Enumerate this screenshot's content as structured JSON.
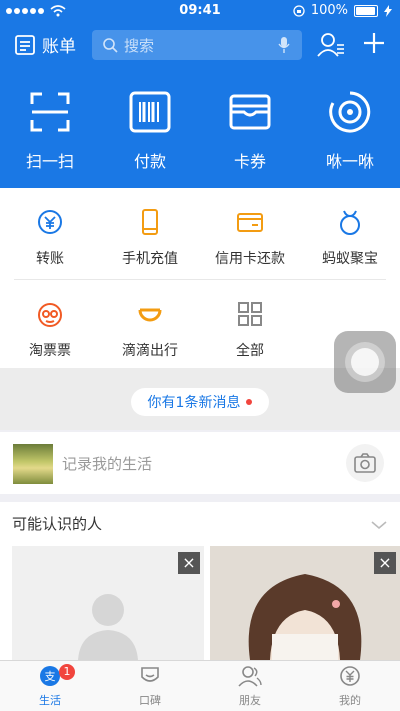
{
  "status": {
    "time": "09:41",
    "battery": "100%"
  },
  "nav": {
    "bill_label": "账单",
    "search_placeholder": "搜索"
  },
  "quick_actions": [
    {
      "label": "扫一扫",
      "icon": "scan-icon"
    },
    {
      "label": "付款",
      "icon": "barcode-icon"
    },
    {
      "label": "卡券",
      "icon": "card-wallet-icon"
    },
    {
      "label": "咻一咻",
      "icon": "xiu-ripple-icon"
    }
  ],
  "services": [
    {
      "label": "转账",
      "icon": "transfer-icon",
      "color": "#1a78e5"
    },
    {
      "label": "手机充值",
      "icon": "phone-recharge-icon",
      "color": "#f39c12"
    },
    {
      "label": "信用卡还款",
      "icon": "credit-card-icon",
      "color": "#f39c12"
    },
    {
      "label": "蚂蚁聚宝",
      "icon": "ant-fortune-icon",
      "color": "#1a78e5"
    },
    {
      "label": "淘票票",
      "icon": "taopiaopiao-icon",
      "color": "#f15a24"
    },
    {
      "label": "滴滴出行",
      "icon": "didi-icon",
      "color": "#f39c12"
    },
    {
      "label": "全部",
      "icon": "grid-all-icon",
      "color": "#888888"
    }
  ],
  "message": {
    "text": "你有1条新消息"
  },
  "record": {
    "text": "记录我的生活"
  },
  "people": {
    "title": "可能认识的人"
  },
  "tabs": [
    {
      "label": "生活",
      "icon": "life-icon",
      "badge": "1"
    },
    {
      "label": "口碑",
      "icon": "koubei-icon"
    },
    {
      "label": "朋友",
      "icon": "friends-icon"
    },
    {
      "label": "我的",
      "icon": "my-wallet-icon"
    }
  ],
  "colors": {
    "brand": "#1a78e5",
    "badge": "#f1453d",
    "accent_orange": "#f39c12"
  }
}
